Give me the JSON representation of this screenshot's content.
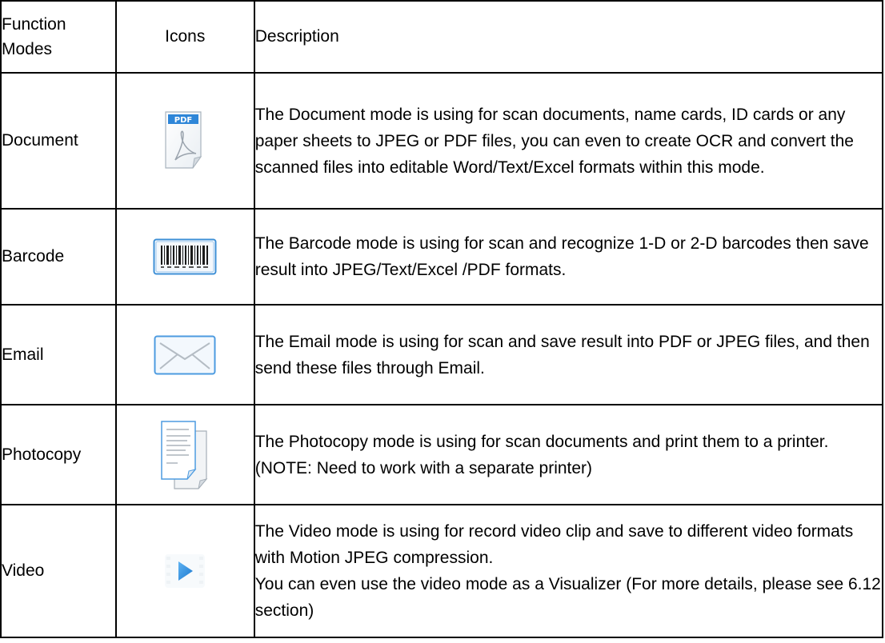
{
  "header": {
    "function_modes": "Function Modes",
    "icons": "Icons",
    "description": "Description"
  },
  "rows": [
    {
      "mode": "Document",
      "icon": "pdf-document-icon",
      "lines": [
        "The Document mode is using for scan documents, name cards, ID cards or any paper sheets to JPEG or PDF files, you can even to create OCR and convert the scanned files into editable Word/Text/Excel formats within this mode."
      ]
    },
    {
      "mode": "Barcode",
      "icon": "barcode-icon",
      "lines": [
        "The Barcode mode is using for scan and recognize 1-D or 2-D barcodes then save result into JPEG/Text/Excel /PDF formats."
      ]
    },
    {
      "mode": "Email",
      "icon": "email-envelope-icon",
      "lines": [
        "The Email mode is using for scan and save result into PDF or JPEG files, and then send these files through Email."
      ]
    },
    {
      "mode": "Photocopy",
      "icon": "photocopy-pages-icon",
      "lines": [
        "The Photocopy mode is using for scan documents and print them to a printer.",
        "(NOTE: Need to work with a separate printer)"
      ]
    },
    {
      "mode": "Video",
      "icon": "video-play-icon",
      "lines": [
        "The Video mode is using for record video clip and save to different video formats with Motion JPEG compression.",
        "You can even use the video mode as a Visualizer (For more details, please see 6.12 section)"
      ]
    }
  ]
}
